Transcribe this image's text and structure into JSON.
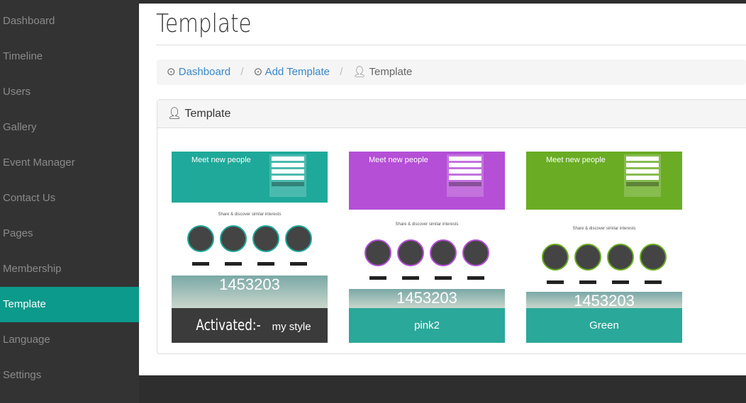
{
  "sidebar": {
    "items": [
      {
        "label": "Dashboard"
      },
      {
        "label": "Timeline"
      },
      {
        "label": "Users"
      },
      {
        "label": "Gallery"
      },
      {
        "label": "Event Manager"
      },
      {
        "label": "Contact Us"
      },
      {
        "label": "Pages"
      },
      {
        "label": "Membership"
      },
      {
        "label": "Template",
        "active": true
      },
      {
        "label": "Language"
      },
      {
        "label": "Settings"
      }
    ]
  },
  "page": {
    "title": "Template"
  },
  "breadcrumb": {
    "items": [
      "Dashboard",
      "Add Template",
      "Template"
    ],
    "icons": [
      "dashboard-icon",
      "dashboard-icon",
      "user-icon"
    ]
  },
  "panel": {
    "title": "Template"
  },
  "templates": [
    {
      "label_prefix": "Activated:-",
      "label": "my style",
      "color": "#1fa99a",
      "label_bg": "#3b3b3b",
      "hero_text": "Meet new people",
      "share_text": "Share & discover similar interests",
      "counter": "1453203"
    },
    {
      "label": "pink2",
      "color": "#b44fd6",
      "label_bg": "#2aa89a",
      "hero_text": "Meet new people",
      "share_text": "Share & discover similar interests",
      "counter": "1453203"
    },
    {
      "label": "Green",
      "color": "#6aac23",
      "label_bg": "#2aa89a",
      "hero_text": "Meet new people",
      "share_text": "Share & discover similar interests",
      "counter": "1453203"
    }
  ],
  "colors": {
    "sidebar_bg": "#333333",
    "active": "#0b9a8b",
    "link": "#3a87c8"
  }
}
